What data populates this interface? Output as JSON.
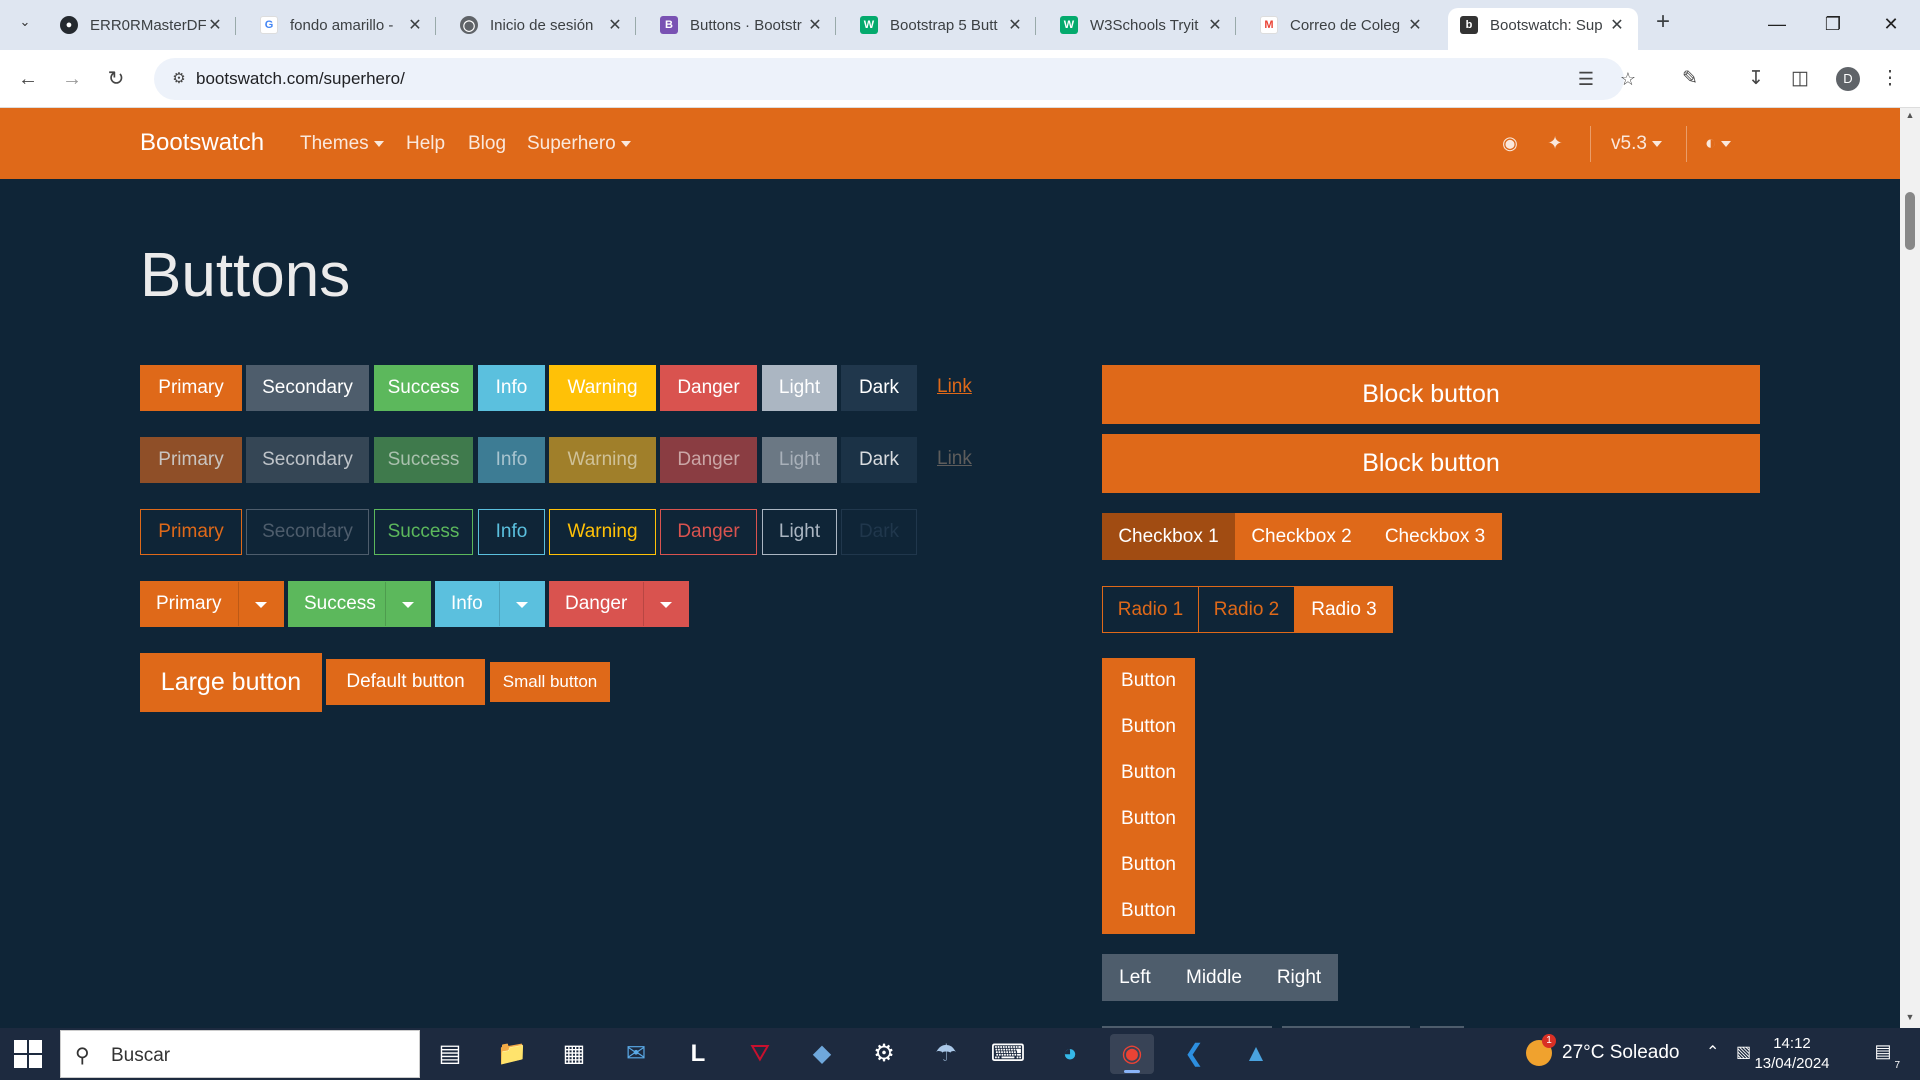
{
  "browser": {
    "tabs": [
      {
        "title": "ERR0RMasterDF/",
        "icon": "github-icon"
      },
      {
        "title": "fondo amarillo -",
        "icon": "google-icon"
      },
      {
        "title": "Inicio de sesión",
        "icon": "globe-icon"
      },
      {
        "title": "Buttons · Bootstr",
        "icon": "bootstrap-icon"
      },
      {
        "title": "Bootstrap 5 Butt",
        "icon": "w3schools-icon"
      },
      {
        "title": "W3Schools Tryit",
        "icon": "w3schools-icon"
      },
      {
        "title": "Correo de Coleg",
        "icon": "gmail-icon"
      },
      {
        "title": "Bootswatch: Sup",
        "icon": "bootswatch-icon"
      }
    ],
    "url": "bootswatch.com/superhero/",
    "profile_initial": "D"
  },
  "navbar": {
    "brand": "Bootswatch",
    "links": [
      "Themes",
      "Help",
      "Blog",
      "Superhero"
    ],
    "version": "v5.3"
  },
  "page": {
    "title": "Buttons",
    "solid_buttons": [
      "Primary",
      "Secondary",
      "Success",
      "Info",
      "Warning",
      "Danger",
      "Light",
      "Dark"
    ],
    "link_label": "Link",
    "disabled_buttons": [
      "Primary",
      "Secondary",
      "Success",
      "Info",
      "Warning",
      "Danger",
      "Light",
      "Dark"
    ],
    "outline_buttons": [
      "Primary",
      "Secondary",
      "Success",
      "Info",
      "Warning",
      "Danger",
      "Light",
      "Dark"
    ],
    "split_buttons": [
      "Primary",
      "Success",
      "Info",
      "Danger"
    ],
    "size_buttons": {
      "large": "Large button",
      "default": "Default button",
      "small": "Small button"
    },
    "block_buttons": [
      "Block button",
      "Block button"
    ],
    "checkboxes": [
      "Checkbox 1",
      "Checkbox 2",
      "Checkbox 3"
    ],
    "radios": [
      "Radio 1",
      "Radio 2",
      "Radio 3"
    ],
    "vertical_buttons": [
      "Button",
      "Button",
      "Button",
      "Button",
      "Button",
      "Button"
    ],
    "horizontal_group": [
      "Left",
      "Middle",
      "Right"
    ]
  },
  "colors": {
    "primary": "#df6919",
    "secondary": "#4e5d6c",
    "success": "#5cb85c",
    "info": "#5bc0de",
    "warning": "#ffc107",
    "danger": "#d9534f",
    "light": "#abb6c2",
    "dark": "#20374c",
    "background": "#0f2537"
  },
  "taskbar": {
    "search_placeholder": "Buscar",
    "weather": "27°C Soleado",
    "weather_badge": "1",
    "time": "14:12",
    "date": "13/04/2024",
    "notification_count": "7"
  }
}
